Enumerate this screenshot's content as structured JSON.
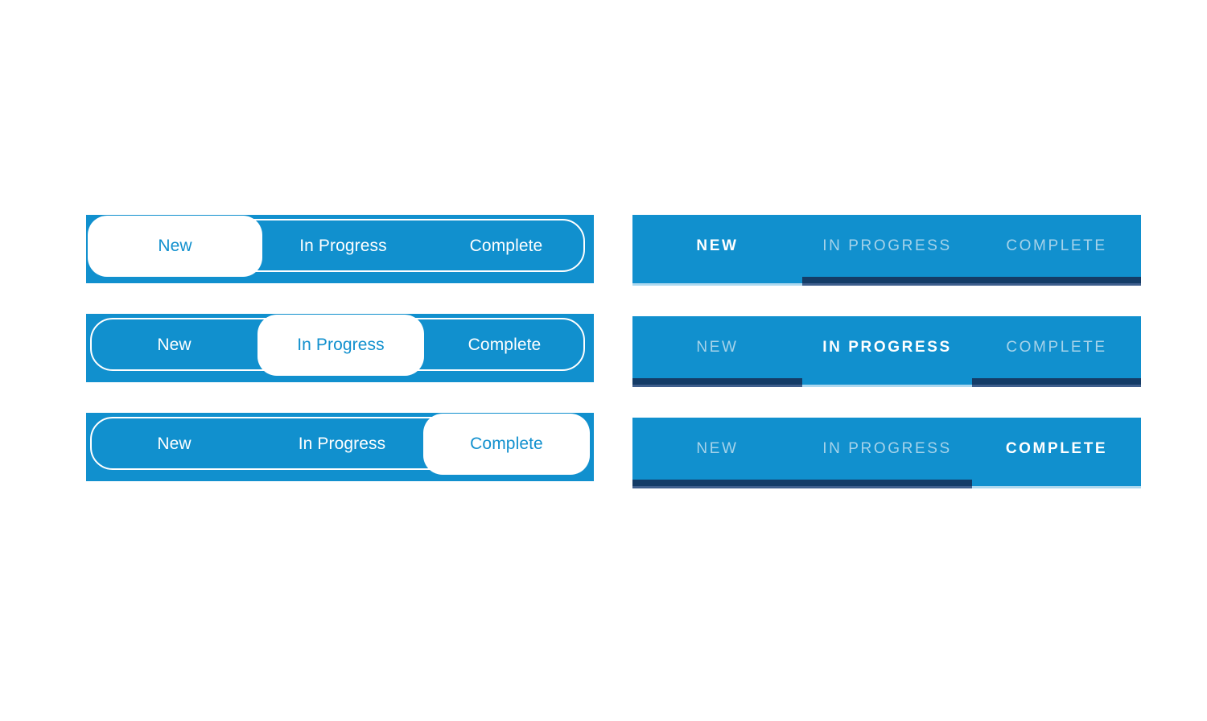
{
  "theme": {
    "brand_blue": "#1190ce",
    "active_pill_bg": "#ffffff",
    "active_pill_text": "#1190ce",
    "inactive_text_light": "#a6d3ea",
    "active_text_white": "#ffffff",
    "underline_inactive": "#143c67",
    "baseline_light": "#9fd1ec",
    "page_background": "#ffffff"
  },
  "segment_labels": {
    "title_case": [
      "New",
      "In Progress",
      "Complete"
    ],
    "upper_case": [
      "NEW",
      "IN PROGRESS",
      "COMPLETE"
    ]
  },
  "pill_groups": [
    {
      "name": "pill-group-new-selected",
      "selected_index": 0,
      "selected_label": "New",
      "segments": [
        {
          "label": "New",
          "state": "active"
        },
        {
          "label": "In Progress",
          "state": "inactive"
        },
        {
          "label": "Complete",
          "state": "inactive"
        }
      ]
    },
    {
      "name": "pill-group-in-progress-selected",
      "selected_index": 1,
      "selected_label": "In Progress",
      "segments": [
        {
          "label": "New",
          "state": "inactive"
        },
        {
          "label": "In Progress",
          "state": "active"
        },
        {
          "label": "Complete",
          "state": "inactive"
        }
      ]
    },
    {
      "name": "pill-group-complete-selected",
      "selected_index": 2,
      "selected_label": "Complete",
      "segments": [
        {
          "label": "New",
          "state": "inactive"
        },
        {
          "label": "In Progress",
          "state": "inactive"
        },
        {
          "label": "Complete",
          "state": "active"
        }
      ]
    }
  ],
  "underline_groups": [
    {
      "name": "underline-group-new-selected",
      "selected_index": 0,
      "selected_label": "NEW",
      "segments": [
        {
          "label": "NEW",
          "state": "active"
        },
        {
          "label": "IN PROGRESS",
          "state": "inactive"
        },
        {
          "label": "COMPLETE",
          "state": "inactive"
        }
      ]
    },
    {
      "name": "underline-group-in-progress-selected",
      "selected_index": 1,
      "selected_label": "IN PROGRESS",
      "segments": [
        {
          "label": "NEW",
          "state": "inactive"
        },
        {
          "label": "IN PROGRESS",
          "state": "active"
        },
        {
          "label": "COMPLETE",
          "state": "inactive"
        }
      ]
    },
    {
      "name": "underline-group-complete-selected",
      "selected_index": 2,
      "selected_label": "COMPLETE",
      "segments": [
        {
          "label": "NEW",
          "state": "inactive"
        },
        {
          "label": "IN PROGRESS",
          "state": "inactive"
        },
        {
          "label": "COMPLETE",
          "state": "active"
        }
      ]
    }
  ]
}
